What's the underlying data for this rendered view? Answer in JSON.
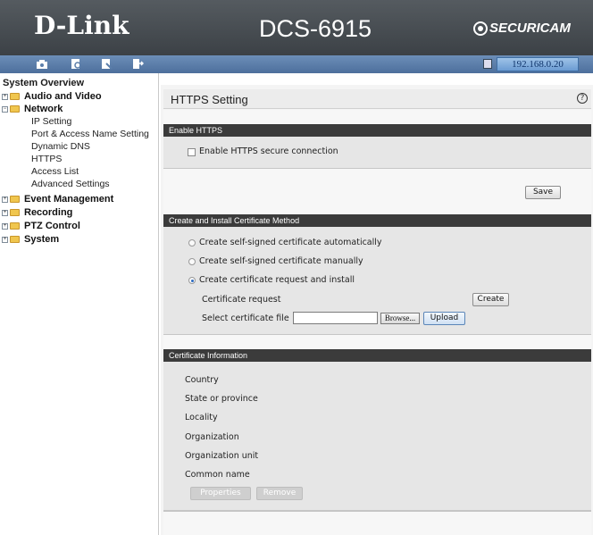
{
  "header": {
    "brand": "D-Link",
    "model": "DCS-6915",
    "securicam": "SECURICAM"
  },
  "toolbar": {
    "icons": [
      "camera-icon",
      "playback-icon",
      "setup-icon",
      "exit-icon"
    ],
    "ip_address": "192.168.0.20"
  },
  "sidebar": {
    "title": "System Overview",
    "groups": [
      {
        "label": "Audio and Video",
        "expanded": false
      },
      {
        "label": "Network",
        "expanded": true,
        "children": [
          "IP Setting",
          "Port & Access Name Setting",
          "Dynamic DNS",
          "HTTPS",
          "Access List",
          "Advanced Settings"
        ]
      },
      {
        "label": "Event Management",
        "expanded": false
      },
      {
        "label": "Recording",
        "expanded": false
      },
      {
        "label": "PTZ Control",
        "expanded": false
      },
      {
        "label": "System",
        "expanded": false
      }
    ]
  },
  "main": {
    "title": "HTTPS Setting",
    "help": "?",
    "enable_section": {
      "header": "Enable HTTPS",
      "checkbox_label": "Enable HTTPS secure connection",
      "checked": false
    },
    "save_label": "Save",
    "cert_method": {
      "header": "Create and Install Certificate Method",
      "options": [
        "Create self-signed certificate automatically",
        "Create self-signed certificate manually",
        "Create certificate request and install"
      ],
      "selected_index": 2,
      "request_label": "Certificate request",
      "create_label": "Create",
      "select_file_label": "Select certificate file",
      "file_value": "",
      "browse_label": "Browse...",
      "upload_label": "Upload"
    },
    "cert_info": {
      "header": "Certificate Information",
      "fields": [
        "Country",
        "State or province",
        "Locality",
        "Organization",
        "Organization unit",
        "Common name"
      ],
      "properties_label": "Properties",
      "remove_label": "Remove"
    }
  }
}
